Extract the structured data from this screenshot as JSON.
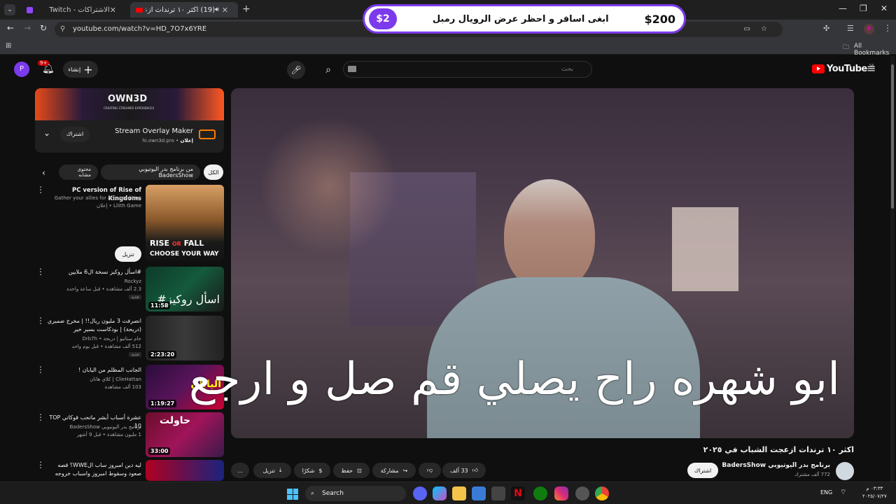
{
  "browser": {
    "tabs": [
      {
        "title": "الاشتراكات - Twitch",
        "active": false
      },
      {
        "title": "(19) اكثر ١٠ ترندات ازعجت الشـ",
        "active": true
      }
    ],
    "new_tab": "+",
    "url": "youtube.com/watch?v=HD_7O7x6YRE",
    "bookmarks_label": "All Bookmarks",
    "profile_initial": "P"
  },
  "promo": {
    "amount": "$200",
    "text": "ابغى اسافر و احظر عرض الرويال رمبل",
    "badge": "$2"
  },
  "youtube": {
    "logo": "YouTube",
    "region": "SA",
    "search_placeholder": "بحث",
    "create_label": "إنشاء",
    "notif_count": "9+",
    "avatar": "P"
  },
  "ad": {
    "banner_text": "OWN3D",
    "banner_sub": "CREATING STREAMER EXPERIENCES",
    "title": "Stream Overlay Maker",
    "sponsor": "إعلان",
    "domain": "hi.own3d.pro",
    "subscribe": "اشتراك"
  },
  "chips": [
    "الكل",
    "من برنامج بدر اليوتيوبي BadersShow",
    "محتوى مشابه"
  ],
  "sidebar": [
    {
      "title": "PC version of Rise of Kingdoms",
      "meta1": "Gather your allies for an expedition",
      "meta2": "إعلان • Lilith Game",
      "duration": "",
      "action": "تنزيل",
      "thumb_text": "RISE OR FALL\nCHOOSE YOUR WAY"
    },
    {
      "title": "#اسأل روكيز نسخة ال6 ملايين",
      "meta1": "Rockyz",
      "meta2": "2.3 ألف مشاهدة • قبل ساعة واحدة",
      "badge": "جديد",
      "duration": "11:58",
      "thumb_text": "#اسأل روكيز"
    },
    {
      "title": "انصرفت 3 مليون ريال!! | مخرج ضميري (دريحة) | بودكاست بسير خير",
      "meta1": "جام ستاتيو | دريحة • Drb7h",
      "meta2": "512 ألف مشاهدة • قبل يوم واحد",
      "badge": "جديد",
      "duration": "2:23:20",
      "thumb_text": ""
    },
    {
      "title": "الجانب المظلم من اليابان !",
      "meta1": "ClieHattan | كلاي هاتان",
      "meta2": "103 ألف مشاهدة",
      "duration": "1:19:27",
      "thumb_text": "اليابان"
    },
    {
      "title": "عشرة أسباب أبشر ماتحب قوكاتي TOP 10",
      "meta1": "برنامج بدر اليوتيوبي BadersShow",
      "meta2": "1 مليون مشاهدة • قبل 9 أشهر",
      "duration": "33:00",
      "thumb_text": "حاولت"
    },
    {
      "title": "ليه دين امبروز ساب الWWE؟ قصه صعود وسقوط امبروز واسباب خروجه",
      "meta1": "",
      "meta2": "",
      "duration": "",
      "thumb_text": ""
    }
  ],
  "video": {
    "caption": "ابو شهره راح يصلي قم صل و ارجع",
    "title": "اكثر ١٠ ترندات ازعجت الشباب في ٢٠٢٥",
    "channel": "برنامج بدر اليوتيوبي BadersShow",
    "subscribers": "772 ألف مشترك",
    "subscribe": "اشتراك",
    "likes": "33 ألف",
    "share": "مشاركة",
    "save": "حفظ",
    "thanks": "شكرًا",
    "download": "تنزيل",
    "more": "..."
  },
  "taskbar": {
    "search": "Search",
    "lang": "ENG",
    "time": "٠٣:٣٣ م",
    "date": "٢٠٢٥/٠٧/٢٧"
  },
  "colors": {
    "accent": "#7c3aed",
    "youtube_red": "#ff0000",
    "bg": "#0f0f0f"
  }
}
